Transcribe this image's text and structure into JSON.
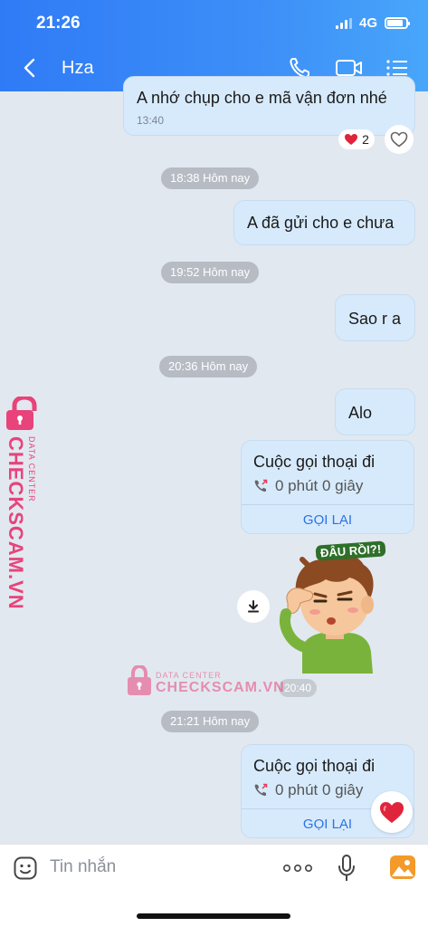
{
  "status_bar": {
    "time": "21:26",
    "network": "4G"
  },
  "header": {
    "contact_name": "Hza"
  },
  "messages": [
    {
      "text": "A nhớ chụp cho e mã vận đơn nhé",
      "time": "13:40",
      "reaction_count": "2"
    },
    {
      "text": "A đã gửi cho e chưa"
    },
    {
      "text": "Sao r a"
    },
    {
      "text": "Alo"
    }
  ],
  "timestamps": [
    "18:38 Hôm nay",
    "19:52 Hôm nay",
    "20:36 Hôm nay",
    "21:21 Hôm nay"
  ],
  "calls": [
    {
      "title": "Cuộc gọi thoại đi",
      "duration": "0 phút 0 giây",
      "action": "GỌI LẠI"
    },
    {
      "title": "Cuộc gọi thoại đi",
      "duration": "0 phút 0 giây",
      "action": "GỌI LẠI"
    }
  ],
  "sticker": {
    "caption": "ĐÂU RỒI?!",
    "time": "20:40"
  },
  "watermark": {
    "brand": "CHECKSCAM.VN",
    "tagline": "DATA CENTER"
  },
  "composer": {
    "placeholder": "Tin nhắn"
  },
  "colors": {
    "header_gradient_start": "#2f7bf6",
    "header_gradient_end": "#48a6fa",
    "bubble": "#d7eafc",
    "link": "#2b72e6",
    "watermark": "#e8437a"
  }
}
